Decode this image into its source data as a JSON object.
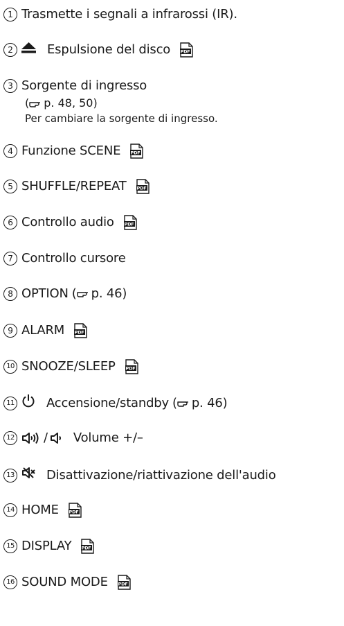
{
  "items": [
    {
      "number": "1",
      "text": "Trasmette i segnali a infrarossi (IR)."
    },
    {
      "number": "2",
      "text": "Espulsione del disco",
      "icon": "eject-icon",
      "pdf": true
    },
    {
      "number": "3",
      "text": "Sorgente di ingresso",
      "ref_text": "p. 48, 50",
      "note": "Per cambiare la sorgente di ingresso."
    },
    {
      "number": "4",
      "text": "Funzione SCENE",
      "pdf": true
    },
    {
      "number": "5",
      "text": "SHUFFLE/REPEAT",
      "pdf": true
    },
    {
      "number": "6",
      "text": "Controllo audio",
      "pdf": true
    },
    {
      "number": "7",
      "text": "Controllo cursore"
    },
    {
      "number": "8",
      "text": "OPTION",
      "ref_text": "p. 46"
    },
    {
      "number": "9",
      "text": "ALARM",
      "pdf": true
    },
    {
      "number": "10",
      "text": "SNOOZE/SLEEP",
      "pdf": true
    },
    {
      "number": "11",
      "text": "Accensione/standby",
      "icon": "power-icon",
      "ref_text": "p. 46"
    },
    {
      "number": "12",
      "text": "Volume +/–",
      "icon": "volume-up-down-icon",
      "icon_separator": "/"
    },
    {
      "number": "13",
      "text": "Disattivazione/riattivazione dell'audio",
      "icon": "mute-icon"
    },
    {
      "number": "14",
      "text": "HOME",
      "pdf": true
    },
    {
      "number": "15",
      "text": "DISPLAY",
      "pdf": true
    },
    {
      "number": "16",
      "text": "SOUND MODE",
      "pdf": true
    }
  ],
  "pdf_icon_label": "PDF",
  "colors": {
    "text": "#1a1a1a",
    "pdf_icon": "#1a1a1a"
  }
}
